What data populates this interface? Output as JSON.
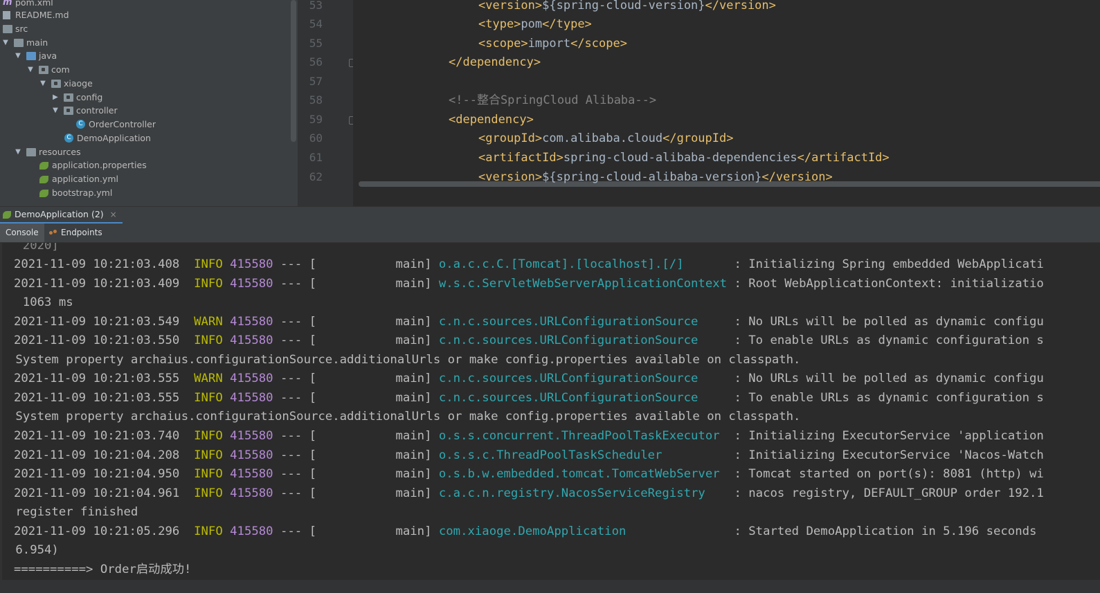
{
  "project_tree": {
    "items": [
      {
        "label": "pom.xml",
        "icon": "maven-icon",
        "depth": 0,
        "arrow": "",
        "kind": "maven"
      },
      {
        "label": "README.md",
        "icon": "markdown-file-icon",
        "depth": 0,
        "arrow": "",
        "kind": "doc"
      },
      {
        "label": "src",
        "icon": "folder-icon",
        "depth": 0,
        "arrow": "",
        "kind": "folder"
      },
      {
        "label": "main",
        "icon": "folder-icon",
        "depth": 0,
        "arrow": "▼",
        "kind": "folder"
      },
      {
        "label": "java",
        "icon": "source-folder-icon",
        "depth": 1,
        "arrow": "▼",
        "kind": "folder-blue"
      },
      {
        "label": "com",
        "icon": "package-icon",
        "depth": 2,
        "arrow": "▼",
        "kind": "package"
      },
      {
        "label": "xiaoge",
        "icon": "package-icon",
        "depth": 3,
        "arrow": "▼",
        "kind": "package"
      },
      {
        "label": "config",
        "icon": "package-icon",
        "depth": 4,
        "arrow": "▶",
        "kind": "package"
      },
      {
        "label": "controller",
        "icon": "package-icon",
        "depth": 4,
        "arrow": "▼",
        "kind": "package"
      },
      {
        "label": "OrderController",
        "icon": "java-class-icon",
        "depth": 6,
        "arrow": "",
        "kind": "class"
      },
      {
        "label": "DemoApplication",
        "icon": "spring-boot-class-icon",
        "depth": 5,
        "arrow": "",
        "kind": "class"
      },
      {
        "label": "resources",
        "icon": "resources-folder-icon",
        "depth": 1,
        "arrow": "▼",
        "kind": "folder"
      },
      {
        "label": "application.properties",
        "icon": "spring-config-icon",
        "depth": 3,
        "arrow": "",
        "kind": "leaf"
      },
      {
        "label": "application.yml",
        "icon": "spring-config-icon",
        "depth": 3,
        "arrow": "",
        "kind": "leaf"
      },
      {
        "label": "bootstrap.yml",
        "icon": "spring-config-icon",
        "depth": 3,
        "arrow": "",
        "kind": "leaf"
      }
    ]
  },
  "editor": {
    "lines": [
      {
        "num": "53",
        "indent": 2,
        "parts": [
          [
            "tag",
            "<version>"
          ],
          [
            "txt",
            "${spring-cloud-version}"
          ],
          [
            "tag",
            "</version>"
          ]
        ]
      },
      {
        "num": "54",
        "indent": 2,
        "parts": [
          [
            "tag",
            "<type>"
          ],
          [
            "txt",
            "pom"
          ],
          [
            "tag",
            "</type>"
          ]
        ]
      },
      {
        "num": "55",
        "indent": 2,
        "parts": [
          [
            "tag",
            "<scope>"
          ],
          [
            "txt",
            "import"
          ],
          [
            "tag",
            "</scope>"
          ]
        ]
      },
      {
        "num": "56",
        "indent": 1,
        "parts": [
          [
            "tag",
            "</dependency>"
          ]
        ],
        "fold": true
      },
      {
        "num": "57",
        "indent": 1,
        "parts": []
      },
      {
        "num": "58",
        "indent": 1,
        "parts": [
          [
            "cmt",
            "<!--整合SpringCloud Alibaba-->"
          ]
        ]
      },
      {
        "num": "59",
        "indent": 1,
        "parts": [
          [
            "tag",
            "<dependency>"
          ]
        ],
        "fold": true
      },
      {
        "num": "60",
        "indent": 2,
        "parts": [
          [
            "tag",
            "<groupId>"
          ],
          [
            "txt",
            "com.alibaba.cloud"
          ],
          [
            "tag",
            "</groupId>"
          ]
        ]
      },
      {
        "num": "61",
        "indent": 2,
        "parts": [
          [
            "tag",
            "<artifactId>"
          ],
          [
            "txt",
            "spring-cloud-alibaba-dependencies"
          ],
          [
            "tag",
            "</artifactId>"
          ]
        ]
      },
      {
        "num": "62",
        "indent": 2,
        "parts": [
          [
            "tag",
            "<version>"
          ],
          [
            "txt",
            "${spring-cloud-alibaba-version}"
          ],
          [
            "tag",
            "</version>"
          ]
        ]
      }
    ]
  },
  "run_window": {
    "tab_label": "DemoApplication (2)",
    "close_glyph": "×",
    "subtabs": {
      "console": "Console",
      "endpoints": "Endpoints"
    }
  },
  "console": {
    "lines": [
      {
        "type": "cont",
        "text": " 2020]",
        "fade": true
      },
      {
        "type": "log",
        "time": "2021-11-09 10:21:03.408",
        "level": "INFO",
        "pid": "415580",
        "sep": " --- [           main] ",
        "logger": "o.a.c.c.C.[Tomcat].[localhost].[/]      ",
        "msg": " : Initializing Spring embedded WebApplicati"
      },
      {
        "type": "log",
        "time": "2021-11-09 10:21:03.409",
        "level": "INFO",
        "pid": "415580",
        "sep": " --- [           main] ",
        "logger": "w.s.c.ServletWebServerApplicationContext",
        "msg": " : Root WebApplicationContext: initializatio"
      },
      {
        "type": "cont",
        "text": " 1063 ms"
      },
      {
        "type": "log",
        "time": "2021-11-09 10:21:03.549",
        "level": "WARN",
        "pid": "415580",
        "sep": " --- [           main] ",
        "logger": "c.n.c.sources.URLConfigurationSource    ",
        "msg": " : No URLs will be polled as dynamic configu"
      },
      {
        "type": "log",
        "time": "2021-11-09 10:21:03.550",
        "level": "INFO",
        "pid": "415580",
        "sep": " --- [           main] ",
        "logger": "c.n.c.sources.URLConfigurationSource    ",
        "msg": " : To enable URLs as dynamic configuration s"
      },
      {
        "type": "cont",
        "text": "System property archaius.configurationSource.additionalUrls or make config.properties available on classpath."
      },
      {
        "type": "log",
        "time": "2021-11-09 10:21:03.555",
        "level": "WARN",
        "pid": "415580",
        "sep": " --- [           main] ",
        "logger": "c.n.c.sources.URLConfigurationSource    ",
        "msg": " : No URLs will be polled as dynamic configu"
      },
      {
        "type": "log",
        "time": "2021-11-09 10:21:03.555",
        "level": "INFO",
        "pid": "415580",
        "sep": " --- [           main] ",
        "logger": "c.n.c.sources.URLConfigurationSource    ",
        "msg": " : To enable URLs as dynamic configuration s"
      },
      {
        "type": "cont",
        "text": "System property archaius.configurationSource.additionalUrls or make config.properties available on classpath."
      },
      {
        "type": "log",
        "time": "2021-11-09 10:21:03.740",
        "level": "INFO",
        "pid": "415580",
        "sep": " --- [           main] ",
        "logger": "o.s.s.concurrent.ThreadPoolTaskExecutor ",
        "msg": " : Initializing ExecutorService 'application"
      },
      {
        "type": "log",
        "time": "2021-11-09 10:21:04.208",
        "level": "INFO",
        "pid": "415580",
        "sep": " --- [           main] ",
        "logger": "o.s.s.c.ThreadPoolTaskScheduler         ",
        "msg": " : Initializing ExecutorService 'Nacos-Watch"
      },
      {
        "type": "log",
        "time": "2021-11-09 10:21:04.950",
        "level": "INFO",
        "pid": "415580",
        "sep": " --- [           main] ",
        "logger": "o.s.b.w.embedded.tomcat.TomcatWebServer ",
        "msg": " : Tomcat started on port(s): 8081 (http) wi"
      },
      {
        "type": "log",
        "time": "2021-11-09 10:21:04.961",
        "level": "INFO",
        "pid": "415580",
        "sep": " --- [           main] ",
        "logger": "c.a.c.n.registry.NacosServiceRegistry   ",
        "msg": " : nacos registry, DEFAULT_GROUP order 192.1"
      },
      {
        "type": "cont",
        "text": "register finished"
      },
      {
        "type": "log",
        "time": "2021-11-09 10:21:05.296",
        "level": "INFO",
        "pid": "415580",
        "sep": " --- [           main] ",
        "logger": "com.xiaoge.DemoApplication              ",
        "msg": " : Started DemoApplication in 5.196 seconds "
      },
      {
        "type": "cont",
        "text": "6.954)"
      },
      {
        "type": "plain",
        "text": "==========> Order启动成功!"
      }
    ]
  },
  "colors": {
    "tag": "#e8bf6a",
    "comment": "#808080",
    "logger": "#2fa8b0",
    "pid": "#b589d6",
    "level": "#bbbb00",
    "accent": "#4a88c7"
  }
}
